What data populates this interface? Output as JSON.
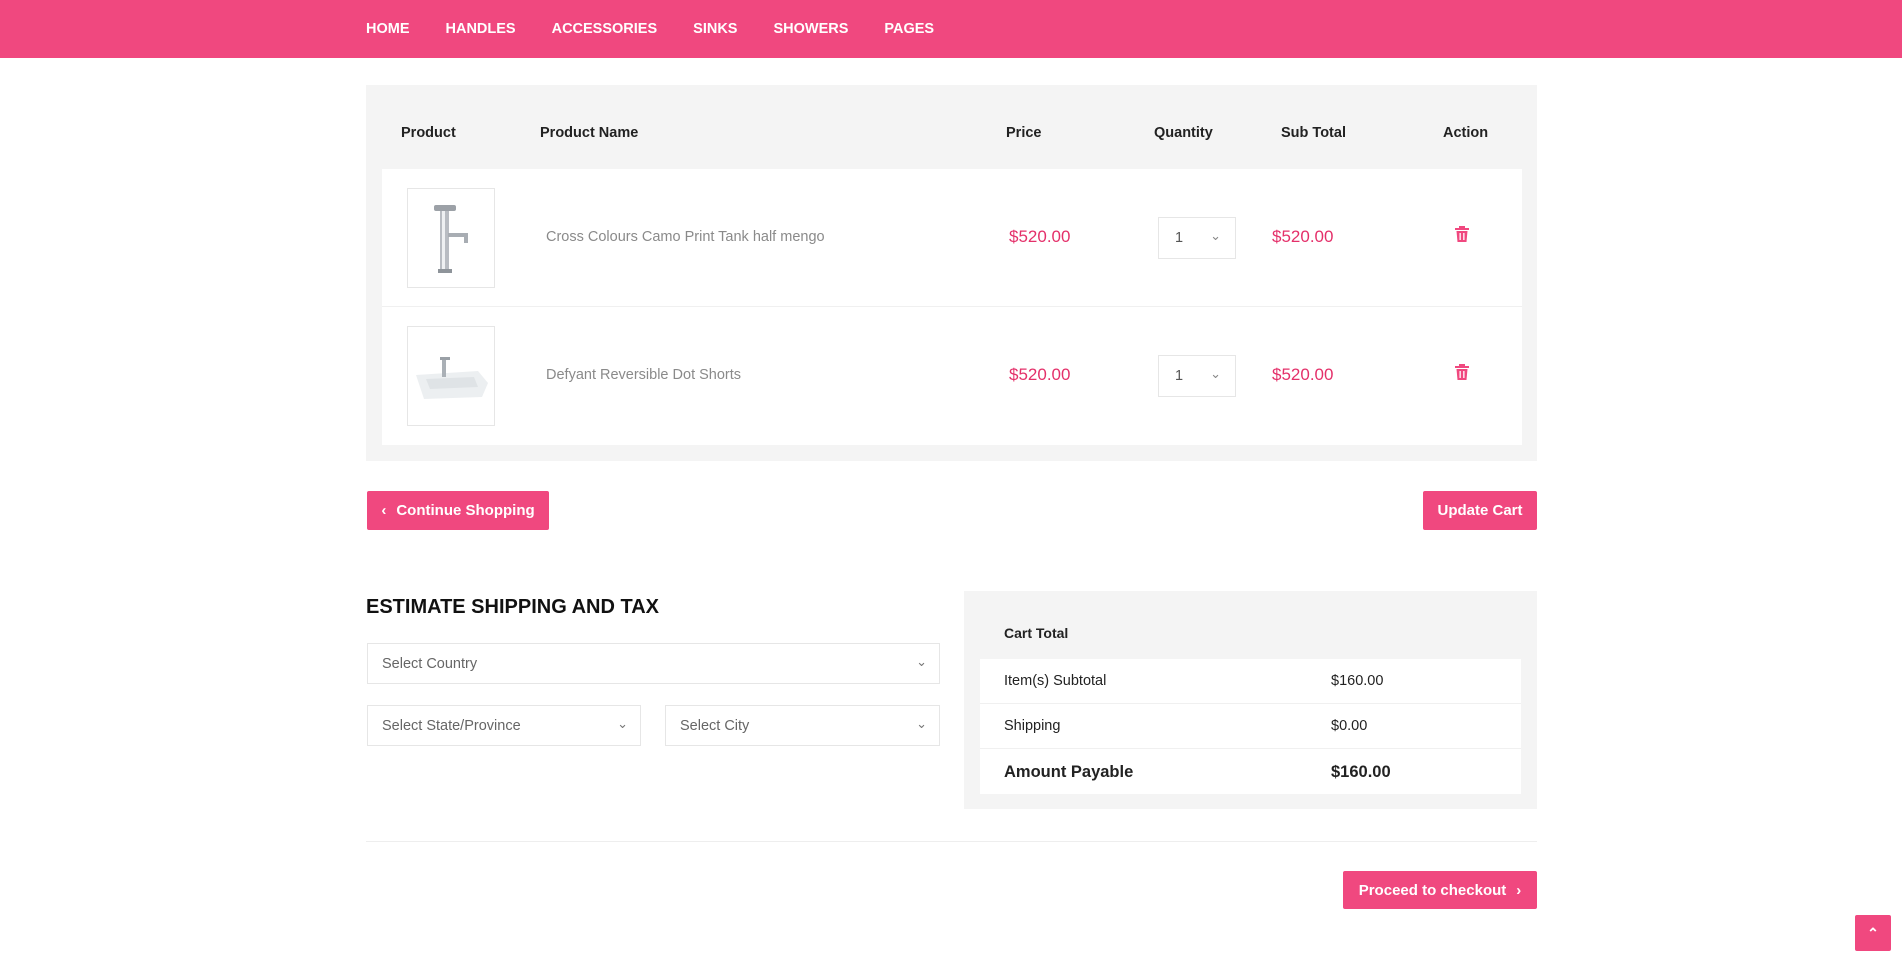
{
  "nav": [
    "HOME",
    "HANDLES",
    "ACCESSORIES",
    "SINKS",
    "SHOWERS",
    "PAGES"
  ],
  "table": {
    "headers": {
      "product": "Product",
      "name": "Product Name",
      "price": "Price",
      "quantity": "Quantity",
      "subtotal": "Sub Total",
      "action": "Action"
    },
    "rows": [
      {
        "image": "faucet",
        "name": "Cross Colours Camo Print Tank half mengo",
        "price": "$520.00",
        "quantity": "1",
        "subtotal": "$520.00"
      },
      {
        "image": "sink",
        "name": "Defyant Reversible Dot Shorts",
        "price": "$520.00",
        "quantity": "1",
        "subtotal": "$520.00"
      }
    ]
  },
  "buttons": {
    "continue": "Continue Shopping",
    "update": "Update Cart",
    "checkout": "Proceed to checkout"
  },
  "shipping": {
    "title": "ESTIMATE SHIPPING AND TAX",
    "country": "Select Country",
    "state": "Select State/Province",
    "city": "Select City"
  },
  "totals": {
    "title": "Cart Total",
    "items": [
      {
        "label": "Item(s) Subtotal",
        "value": "$160.00"
      },
      {
        "label": "Shipping",
        "value": "$0.00"
      },
      {
        "label": "Amount Payable",
        "value": "$160.00"
      }
    ]
  },
  "colors": {
    "accent": "#f0487f",
    "price": "#e4306a"
  }
}
